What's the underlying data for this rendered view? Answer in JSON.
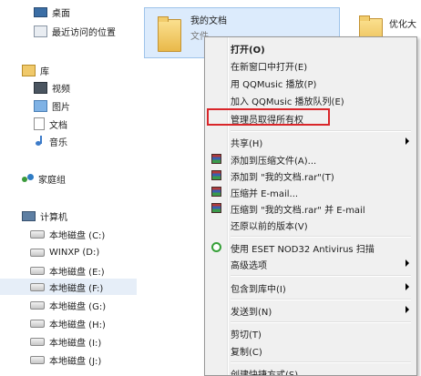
{
  "nav": {
    "items": [
      {
        "label": "桌面",
        "icon": "desktop-icon"
      },
      {
        "label": "最近访问的位置",
        "icon": "recent-places-icon"
      },
      {
        "label": "库",
        "icon": "library-icon"
      },
      {
        "label": "视频",
        "icon": "video-icon"
      },
      {
        "label": "图片",
        "icon": "pictures-icon"
      },
      {
        "label": "文档",
        "icon": "documents-icon"
      },
      {
        "label": "音乐",
        "icon": "music-icon"
      },
      {
        "label": "家庭组",
        "icon": "homegroup-icon"
      },
      {
        "label": "计算机",
        "icon": "computer-icon"
      },
      {
        "label": "本地磁盘 (C:)",
        "icon": "drive-icon"
      },
      {
        "label": "WINXP (D:)",
        "icon": "drive-icon"
      },
      {
        "label": "本地磁盘 (E:)",
        "icon": "drive-icon"
      },
      {
        "label": "本地磁盘 (F:)",
        "icon": "drive-icon",
        "selected": true
      },
      {
        "label": "本地磁盘 (G:)",
        "icon": "drive-icon"
      },
      {
        "label": "本地磁盘 (H:)",
        "icon": "drive-icon"
      },
      {
        "label": "本地磁盘 (I:)",
        "icon": "drive-icon"
      },
      {
        "label": "本地磁盘 (J:)",
        "icon": "drive-icon"
      }
    ]
  },
  "files": [
    {
      "title": "我的文档",
      "subtitle": "文件"
    },
    {
      "title": "优化大"
    }
  ],
  "context_menu": {
    "items": [
      {
        "label": "打开(O)",
        "bold": true
      },
      {
        "label": "在新窗口中打开(E)"
      },
      {
        "label": "用 QQMusic 播放(P)"
      },
      {
        "label": "加入 QQMusic 播放队列(E)"
      },
      {
        "label": "管理员取得所有权",
        "highlighted": true
      },
      {
        "label": "共享(H)",
        "submenu": true
      },
      {
        "label": "添加到压缩文件(A)...",
        "icon": "winrar-icon"
      },
      {
        "label": "添加到 \"我的文档.rar\"(T)",
        "icon": "winrar-icon"
      },
      {
        "label": "压缩并 E-mail...",
        "icon": "winrar-icon"
      },
      {
        "label": "压缩到 \"我的文档.rar\" 并 E-mail",
        "icon": "winrar-icon"
      },
      {
        "label": "还原以前的版本(V)"
      },
      {
        "label": "使用 ESET NOD32 Antivirus 扫描",
        "icon": "eset-icon"
      },
      {
        "label": "高级选项",
        "submenu": true
      },
      {
        "label": "包含到库中(I)",
        "submenu": true
      },
      {
        "label": "发送到(N)",
        "submenu": true
      },
      {
        "label": "剪切(T)"
      },
      {
        "label": "复制(C)"
      },
      {
        "label": "创建快捷方式(S)"
      }
    ]
  },
  "colors": {
    "highlight_border": "#d9262a",
    "selection": "#dcebfc"
  }
}
